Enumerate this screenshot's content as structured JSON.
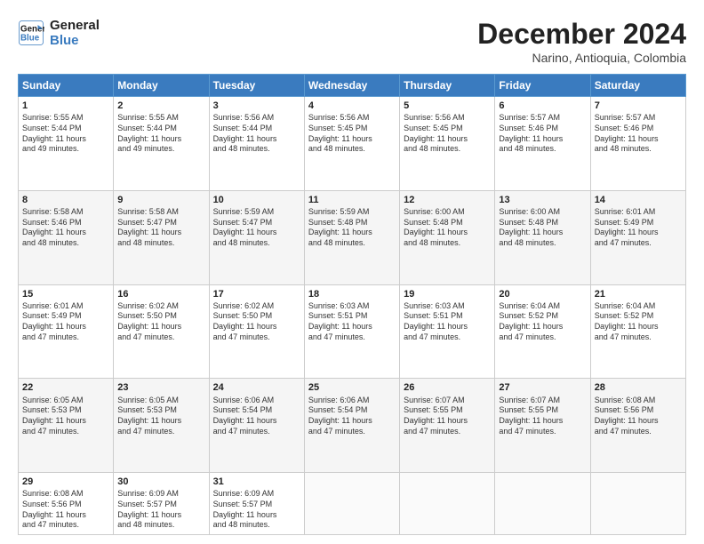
{
  "header": {
    "logo_line1": "General",
    "logo_line2": "Blue",
    "month": "December 2024",
    "location": "Narino, Antioquia, Colombia"
  },
  "days_of_week": [
    "Sunday",
    "Monday",
    "Tuesday",
    "Wednesday",
    "Thursday",
    "Friday",
    "Saturday"
  ],
  "weeks": [
    [
      {
        "day": "1",
        "info": "Sunrise: 5:55 AM\nSunset: 5:44 PM\nDaylight: 11 hours\nand 49 minutes."
      },
      {
        "day": "2",
        "info": "Sunrise: 5:55 AM\nSunset: 5:44 PM\nDaylight: 11 hours\nand 49 minutes."
      },
      {
        "day": "3",
        "info": "Sunrise: 5:56 AM\nSunset: 5:44 PM\nDaylight: 11 hours\nand 48 minutes."
      },
      {
        "day": "4",
        "info": "Sunrise: 5:56 AM\nSunset: 5:45 PM\nDaylight: 11 hours\nand 48 minutes."
      },
      {
        "day": "5",
        "info": "Sunrise: 5:56 AM\nSunset: 5:45 PM\nDaylight: 11 hours\nand 48 minutes."
      },
      {
        "day": "6",
        "info": "Sunrise: 5:57 AM\nSunset: 5:46 PM\nDaylight: 11 hours\nand 48 minutes."
      },
      {
        "day": "7",
        "info": "Sunrise: 5:57 AM\nSunset: 5:46 PM\nDaylight: 11 hours\nand 48 minutes."
      }
    ],
    [
      {
        "day": "8",
        "info": "Sunrise: 5:58 AM\nSunset: 5:46 PM\nDaylight: 11 hours\nand 48 minutes."
      },
      {
        "day": "9",
        "info": "Sunrise: 5:58 AM\nSunset: 5:47 PM\nDaylight: 11 hours\nand 48 minutes."
      },
      {
        "day": "10",
        "info": "Sunrise: 5:59 AM\nSunset: 5:47 PM\nDaylight: 11 hours\nand 48 minutes."
      },
      {
        "day": "11",
        "info": "Sunrise: 5:59 AM\nSunset: 5:48 PM\nDaylight: 11 hours\nand 48 minutes."
      },
      {
        "day": "12",
        "info": "Sunrise: 6:00 AM\nSunset: 5:48 PM\nDaylight: 11 hours\nand 48 minutes."
      },
      {
        "day": "13",
        "info": "Sunrise: 6:00 AM\nSunset: 5:48 PM\nDaylight: 11 hours\nand 48 minutes."
      },
      {
        "day": "14",
        "info": "Sunrise: 6:01 AM\nSunset: 5:49 PM\nDaylight: 11 hours\nand 47 minutes."
      }
    ],
    [
      {
        "day": "15",
        "info": "Sunrise: 6:01 AM\nSunset: 5:49 PM\nDaylight: 11 hours\nand 47 minutes."
      },
      {
        "day": "16",
        "info": "Sunrise: 6:02 AM\nSunset: 5:50 PM\nDaylight: 11 hours\nand 47 minutes."
      },
      {
        "day": "17",
        "info": "Sunrise: 6:02 AM\nSunset: 5:50 PM\nDaylight: 11 hours\nand 47 minutes."
      },
      {
        "day": "18",
        "info": "Sunrise: 6:03 AM\nSunset: 5:51 PM\nDaylight: 11 hours\nand 47 minutes."
      },
      {
        "day": "19",
        "info": "Sunrise: 6:03 AM\nSunset: 5:51 PM\nDaylight: 11 hours\nand 47 minutes."
      },
      {
        "day": "20",
        "info": "Sunrise: 6:04 AM\nSunset: 5:52 PM\nDaylight: 11 hours\nand 47 minutes."
      },
      {
        "day": "21",
        "info": "Sunrise: 6:04 AM\nSunset: 5:52 PM\nDaylight: 11 hours\nand 47 minutes."
      }
    ],
    [
      {
        "day": "22",
        "info": "Sunrise: 6:05 AM\nSunset: 5:53 PM\nDaylight: 11 hours\nand 47 minutes."
      },
      {
        "day": "23",
        "info": "Sunrise: 6:05 AM\nSunset: 5:53 PM\nDaylight: 11 hours\nand 47 minutes."
      },
      {
        "day": "24",
        "info": "Sunrise: 6:06 AM\nSunset: 5:54 PM\nDaylight: 11 hours\nand 47 minutes."
      },
      {
        "day": "25",
        "info": "Sunrise: 6:06 AM\nSunset: 5:54 PM\nDaylight: 11 hours\nand 47 minutes."
      },
      {
        "day": "26",
        "info": "Sunrise: 6:07 AM\nSunset: 5:55 PM\nDaylight: 11 hours\nand 47 minutes."
      },
      {
        "day": "27",
        "info": "Sunrise: 6:07 AM\nSunset: 5:55 PM\nDaylight: 11 hours\nand 47 minutes."
      },
      {
        "day": "28",
        "info": "Sunrise: 6:08 AM\nSunset: 5:56 PM\nDaylight: 11 hours\nand 47 minutes."
      }
    ],
    [
      {
        "day": "29",
        "info": "Sunrise: 6:08 AM\nSunset: 5:56 PM\nDaylight: 11 hours\nand 47 minutes."
      },
      {
        "day": "30",
        "info": "Sunrise: 6:09 AM\nSunset: 5:57 PM\nDaylight: 11 hours\nand 48 minutes."
      },
      {
        "day": "31",
        "info": "Sunrise: 6:09 AM\nSunset: 5:57 PM\nDaylight: 11 hours\nand 48 minutes."
      },
      {
        "day": "",
        "info": ""
      },
      {
        "day": "",
        "info": ""
      },
      {
        "day": "",
        "info": ""
      },
      {
        "day": "",
        "info": ""
      }
    ]
  ]
}
